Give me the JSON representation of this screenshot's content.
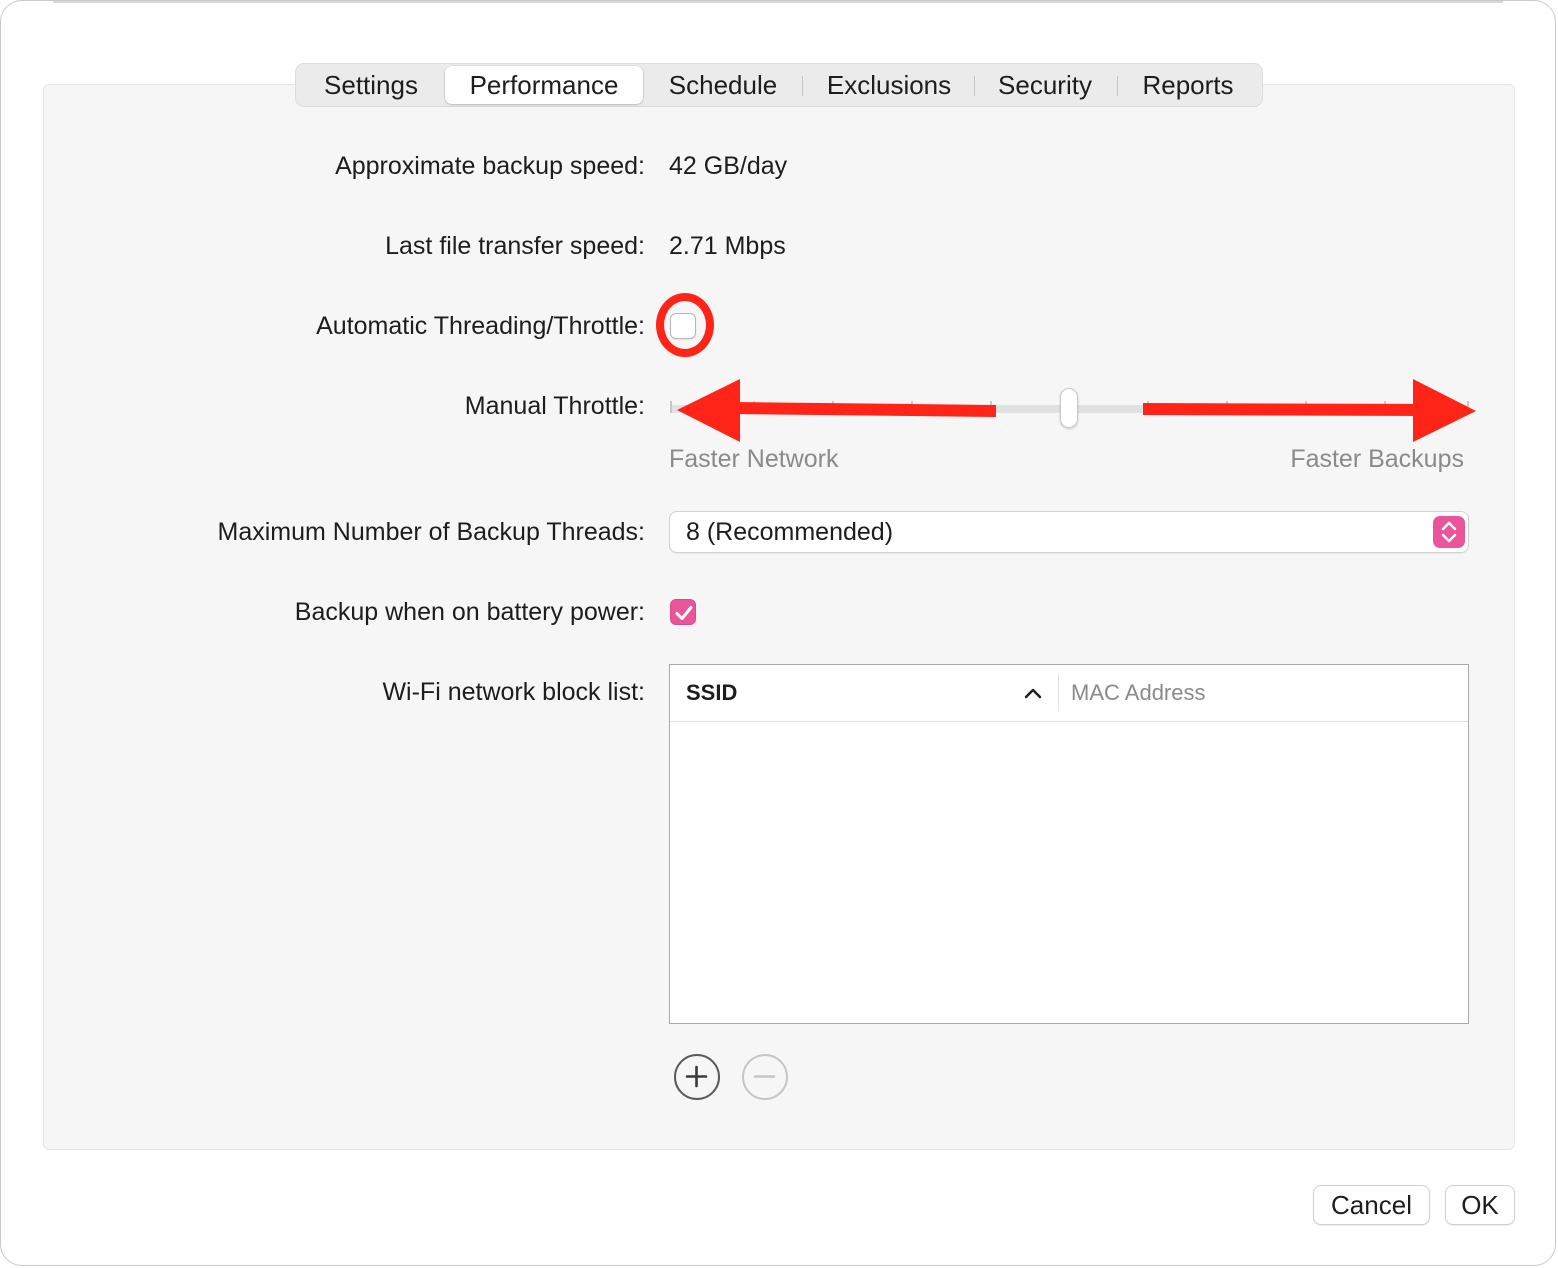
{
  "tabs": [
    {
      "label": "Settings",
      "active": false
    },
    {
      "label": "Performance",
      "active": true
    },
    {
      "label": "Schedule",
      "active": false
    },
    {
      "label": "Exclusions",
      "active": false
    },
    {
      "label": "Security",
      "active": false
    },
    {
      "label": "Reports",
      "active": false
    }
  ],
  "performance": {
    "backup_speed_label": "Approximate backup speed:",
    "backup_speed_value": "42 GB/day",
    "transfer_speed_label": "Last file transfer speed:",
    "transfer_speed_value": "2.71 Mbps",
    "auto_throttle_label": "Automatic Threading/Throttle:",
    "auto_throttle_checked": false,
    "manual_throttle_label": "Manual Throttle:",
    "slider_min_label": "Faster Network",
    "slider_max_label": "Faster Backups",
    "slider_value_fraction": 0.5,
    "max_threads_label": "Maximum Number of Backup Threads:",
    "max_threads_value": "8 (Recommended)",
    "battery_label": "Backup when on battery power:",
    "battery_checked": true,
    "wifi_label": "Wi-Fi network block list:",
    "wifi_table": {
      "columns": [
        "SSID",
        "MAC Address"
      ],
      "sorted_column": "SSID",
      "sort_direction": "ascending",
      "rows": []
    }
  },
  "buttons": {
    "cancel": "Cancel",
    "ok": "OK"
  },
  "icons": {
    "add": "plus-circle-icon",
    "remove": "minus-circle-icon",
    "checkmark": "checkmark-icon",
    "stepper": "up-down-chevron-icon",
    "sort": "chevron-up-icon"
  },
  "colors": {
    "accent": "#e9549b",
    "annotation": "#ff2418"
  }
}
